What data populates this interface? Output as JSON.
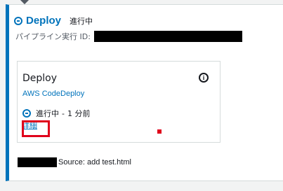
{
  "stage": {
    "title": "Deploy",
    "status": "進行中",
    "pipeline_id_label": "パイプライン実行 ID:",
    "accent_color": "#0073bb"
  },
  "action": {
    "title": "Deploy",
    "provider": "AWS CodeDeploy",
    "status": "進行中",
    "separator": "-",
    "time_ago": "1 分前",
    "details_link": "詳細",
    "info_icon": "i"
  },
  "source": {
    "text": "Source: add test.html"
  },
  "annotation": {
    "highlight_color": "#e0001b"
  }
}
